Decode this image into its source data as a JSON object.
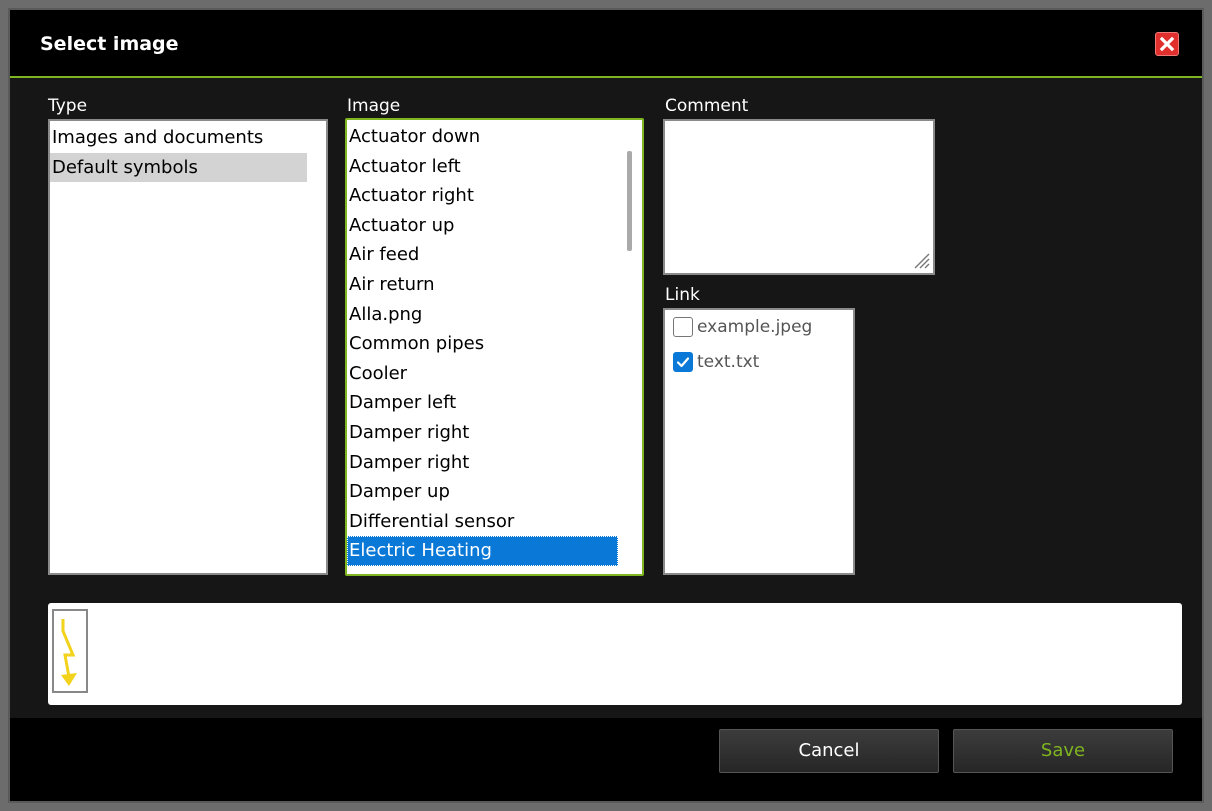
{
  "dialog": {
    "title": "Select image",
    "close_icon": "close-x-icon"
  },
  "type_panel": {
    "label": "Type",
    "items": [
      "Images and documents",
      "Default symbols"
    ],
    "selected": "Default symbols"
  },
  "image_panel": {
    "label": "Image",
    "items": [
      "Actuator down",
      "Actuator left",
      "Actuator right",
      "Actuator up",
      "Air feed",
      "Air return",
      "Alla.png",
      "Common pipes",
      "Cooler",
      "Damper left",
      "Damper right",
      "Damper right",
      "Damper up",
      "Differential sensor",
      "Electric Heating"
    ],
    "selected": "Electric Heating"
  },
  "comment_panel": {
    "label": "Comment",
    "value": ""
  },
  "link_panel": {
    "label": "Link",
    "links": [
      {
        "name": "example.jpeg",
        "checked": false
      },
      {
        "name": "text.txt",
        "checked": true
      }
    ]
  },
  "preview": {
    "symbol_icon": "electric-heating-lightning-icon"
  },
  "footer": {
    "cancel_label": "Cancel",
    "save_label": "Save"
  },
  "colors": {
    "accent_green": "#7fb51f",
    "selection_blue": "#0a78d7",
    "close_red": "#e0302d",
    "symbol_yellow": "#f2d21a"
  }
}
